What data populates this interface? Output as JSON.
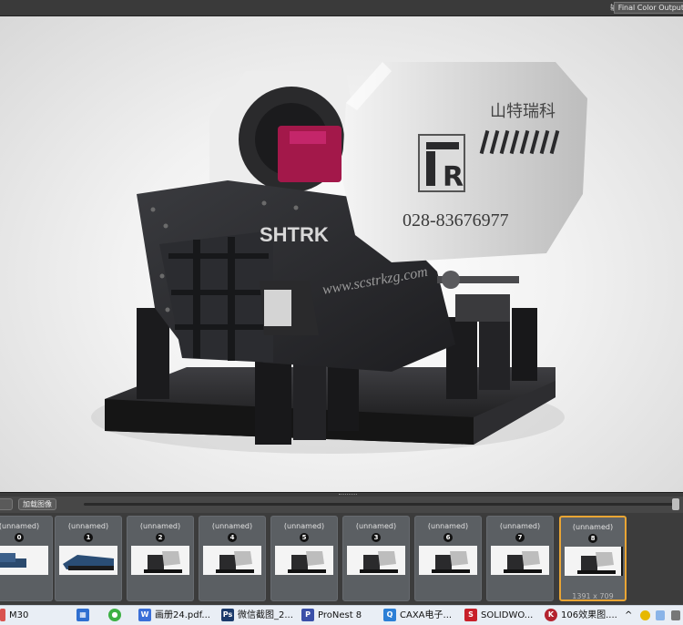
{
  "topbar": {
    "output_label": "输出",
    "output_value": "Final Color Output"
  },
  "viewport": {
    "render": {
      "panel_text": "山特瑞科",
      "logo_letter": "R",
      "phone": "028-83676977",
      "brand": "SHTRK",
      "website": "www.scstrkzg.com"
    }
  },
  "film_toolbar": {
    "load_button": "加载图像"
  },
  "filmstrip": {
    "thumbs": [
      {
        "name": "(unnamed)",
        "num": "0",
        "size": ""
      },
      {
        "name": "(unnamed)",
        "num": "1",
        "size": ""
      },
      {
        "name": "(unnamed)",
        "num": "2",
        "size": ""
      },
      {
        "name": "(unnamed)",
        "num": "4",
        "size": ""
      },
      {
        "name": "(unnamed)",
        "num": "5",
        "size": ""
      },
      {
        "name": "(unnamed)",
        "num": "3",
        "size": ""
      },
      {
        "name": "(unnamed)",
        "num": "6",
        "size": ""
      },
      {
        "name": "(unnamed)",
        "num": "7",
        "size": ""
      },
      {
        "name": "(unnamed)",
        "num": "8",
        "size": "1391 x 709"
      }
    ]
  },
  "taskbar": {
    "items": [
      {
        "label": "M30",
        "icon": "app-icon",
        "color": "#d9534f"
      },
      {
        "label": "",
        "icon": "calculator-icon",
        "color": "#2f6fd0"
      },
      {
        "label": "",
        "icon": "wechat-icon",
        "color": "#3cb043"
      },
      {
        "label": "画册24.pdf...",
        "icon": "pdf-icon",
        "color": "#3a6fd8"
      },
      {
        "label": "微信截图_2...",
        "icon": "photoshop-icon",
        "color": "#1b3a6b"
      },
      {
        "label": "ProNest 8",
        "icon": "pronest-icon",
        "color": "#3a4fa8"
      },
      {
        "label": "CAXA电子...",
        "icon": "caxa-icon",
        "color": "#2c7fd6"
      },
      {
        "label": "SOLIDWO...",
        "icon": "solidworks-icon",
        "color": "#c8202a"
      },
      {
        "label": "106效果图....",
        "icon": "keyshot-icon",
        "color": "#b3232f"
      }
    ],
    "tray_chevron": "^"
  }
}
